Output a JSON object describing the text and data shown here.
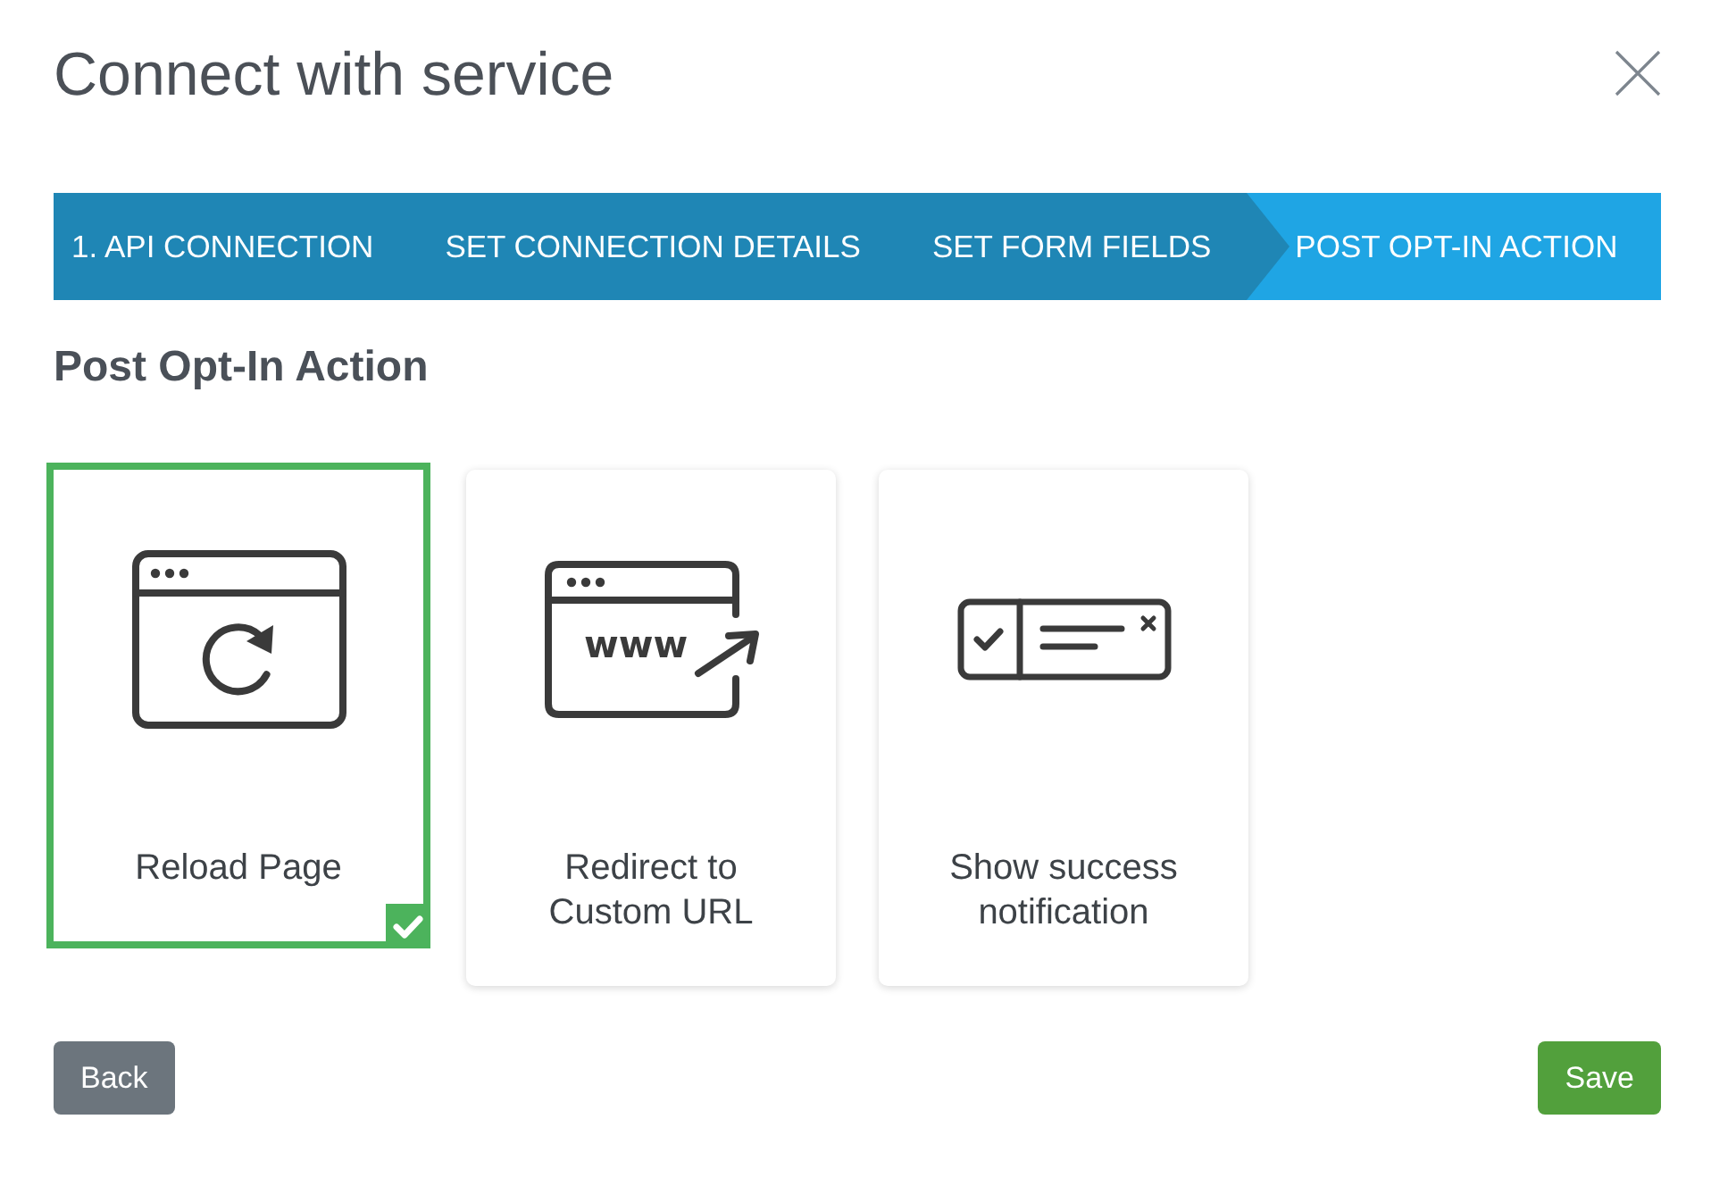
{
  "dialog": {
    "title": "Connect with service"
  },
  "steps": [
    {
      "label": "1. API CONNECTION",
      "selected": false
    },
    {
      "label": "SET CONNECTION DETAILS",
      "selected": false
    },
    {
      "label": "SET FORM FIELDS",
      "selected": false
    },
    {
      "label": "POST OPT-IN ACTION",
      "selected": true
    }
  ],
  "section": {
    "heading": "Post Opt-In Action"
  },
  "options": [
    {
      "kind": "reload",
      "label": "Reload Page",
      "selected": true
    },
    {
      "kind": "redirect",
      "label": "Redirect to Custom URL",
      "icon_text": "www",
      "selected": false
    },
    {
      "kind": "notification",
      "label": "Show success notification",
      "selected": false
    }
  ],
  "buttons": [
    {
      "kind": "back",
      "label": "Back"
    },
    {
      "kind": "save",
      "label": "Save"
    }
  ]
}
